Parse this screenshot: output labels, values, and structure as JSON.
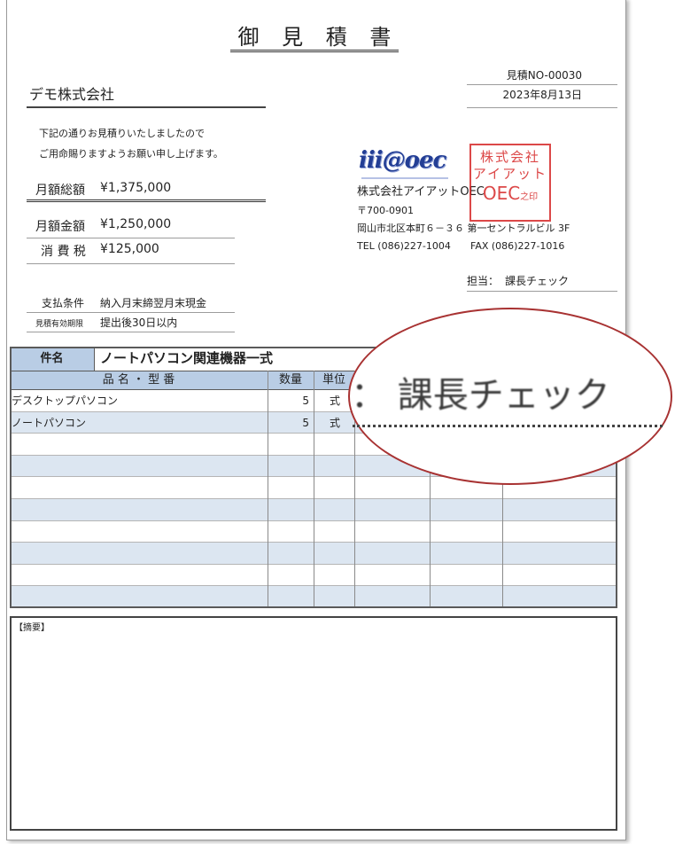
{
  "title": "御 見 積 書",
  "quote_no": "見積NO-00030",
  "date": "2023年8月13日",
  "client": "デモ株式会社",
  "intro": [
    "下記の通りお見積りいたしましたので",
    "ご用命賜りますようお願い申し上げます。"
  ],
  "totals": {
    "monthly_total_label": "月額総額",
    "monthly_total_value": "¥1,375,000",
    "monthly_amount_label": "月額金額",
    "monthly_amount_value": "¥1,250,000",
    "tax_label": "消 費 税",
    "tax_value": "¥125,000"
  },
  "terms": {
    "payment_label": "支払条件",
    "payment_value": "納入月末締翌月末現金",
    "validity_label": "見積有効期限",
    "validity_value": "提出後30日以内"
  },
  "company": {
    "logo": "iii@oec",
    "seal_lines": [
      "株式会社",
      "アイアット",
      "OEC",
      "之印"
    ],
    "seal_color": "#d62828",
    "name": "株式会社アイアットOEC",
    "postal": "〒700-0901",
    "address": "岡山市北区本町６－３６ 第一セントラルビル 3F",
    "tel": "TEL (086)227-1004",
    "fax": "FAX (086)227-1016"
  },
  "contact": {
    "label": "担当：",
    "value": "課長チェック"
  },
  "table": {
    "subject_label": "件名",
    "subject": "ノートパソコン関連機器一式",
    "headers": [
      "品 名 ・ 型 番",
      "数量",
      "単位"
    ],
    "rows": [
      {
        "name": "デスクトップパソコン",
        "qty": "5",
        "unit": "式"
      },
      {
        "name": "ノートパソコン",
        "qty": "5",
        "unit": "式"
      }
    ],
    "header_color": "#b9cde5",
    "stripe_color": "#dce6f1"
  },
  "notes_label": "【摘要】",
  "callout": {
    "text": "： 課長チェック",
    "border_color": "#a83232"
  }
}
